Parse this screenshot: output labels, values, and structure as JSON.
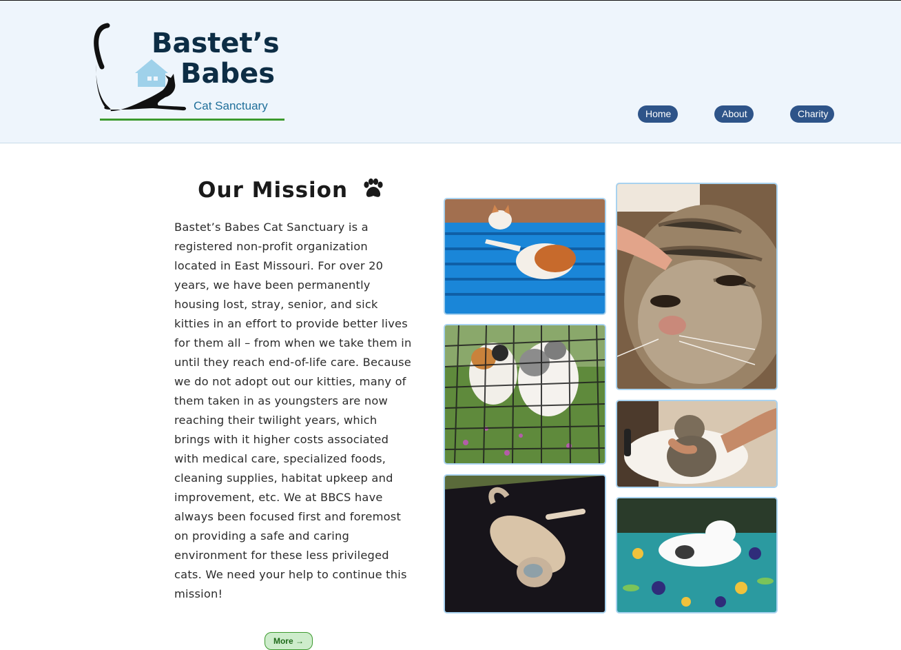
{
  "brand": {
    "name_line1": "Bastet’s",
    "name_line2": "Babes",
    "subtitle": "Cat Sanctuary",
    "colors": {
      "title": "#0d2d45",
      "subtitle": "#1f6f9a",
      "underline": "#3c9a2e"
    }
  },
  "nav": {
    "items": [
      {
        "label": "Home"
      },
      {
        "label": "About"
      },
      {
        "label": "Charity"
      }
    ],
    "color": "#2e5489"
  },
  "mission": {
    "title": "Our Mission",
    "icon": "paw-icon",
    "body": "Bastet’s Babes Cat Sanctuary is a registered non-profit organization located in East Missouri. For over 20 years, we have been permanently housing lost, stray, senior, and sick kitties in an effort to provide better lives for them all – from when we take them in until they reach end-of-life care. Because we do not adopt out our kitties, many of them taken in as youngsters are now reaching their twilight years, which brings with it higher costs associated with medical care, specialized foods, cleaning supplies, habitat upkeep and improvement, etc. We at BBCS have always been focused first and foremost on providing a safe and caring environment for these less privileged cats. We need your help to continue this mission!",
    "more_label": "More →"
  },
  "gallery": {
    "photos": [
      {
        "subject": "orange-white-cat-on-blue-bench"
      },
      {
        "subject": "calico-cats-behind-fence"
      },
      {
        "subject": "tabby-cat-lying-on-dark-mat"
      },
      {
        "subject": "tabby-cat-closeup-being-petted"
      },
      {
        "subject": "tabby-cat-in-sink"
      },
      {
        "subject": "white-cat-on-floral-cushion"
      }
    ]
  }
}
